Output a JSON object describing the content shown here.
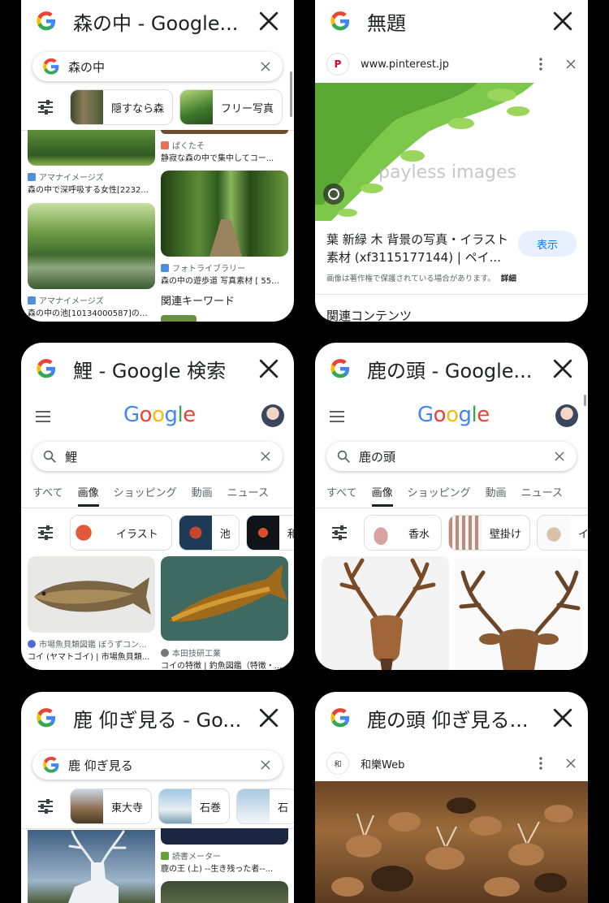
{
  "tabs": [
    {
      "title": "森の中 - Google...",
      "search_query": "森の中",
      "chips": [
        "隠すなら森",
        "フリー写真"
      ],
      "results": [
        {
          "source": "ぱくたそ",
          "caption": "静寂な森の中で集中してコー..."
        },
        {
          "source": "アマナイメージズ",
          "caption": "森の中で深呼吸する女性[2232..."
        },
        {
          "source": "フォトライブラリー",
          "caption": "森の中の遊歩道 写真素材 [ 557..."
        },
        {
          "source": "アマナイメージズ",
          "caption": "森の中の池[10134000587]の写..."
        }
      ],
      "related_label": "関連キーワード"
    },
    {
      "title": "無題",
      "site": "www.pinterest.jp",
      "watermark": "payless images",
      "result_title": "葉 新緑 木 背景の写真・イラスト素材 (xf3115177144) | ペイ...",
      "view_button": "表示",
      "copyright_note": "画像は著作権で保護されている場合があります。",
      "details_link": "詳細",
      "related_content": "関連コンテンツ"
    },
    {
      "title": "鯉 - Google 検索",
      "google_word": "Google",
      "search_query": "鯉",
      "nav_tabs": [
        "すべて",
        "画像",
        "ショッピング",
        "動画",
        "ニュース"
      ],
      "chips": [
        "イラスト",
        "池",
        "和"
      ],
      "results": [
        {
          "source": "市場魚貝類図鑑 ぼうずコン...",
          "caption": "コイ (ヤマトゴイ) | 市場魚貝類..."
        },
        {
          "source": "本田技研工業",
          "caption": "コイの特徴 | 釣魚図鑑（特徴・..."
        }
      ]
    },
    {
      "title": "鹿の頭 - Google...",
      "google_word": "Google",
      "search_query": "鹿の頭",
      "nav_tabs": [
        "すべて",
        "画像",
        "ショッピング",
        "動画",
        "ニュース"
      ],
      "chips": [
        "香水",
        "壁掛け",
        "イ"
      ]
    },
    {
      "title": "鹿 仰ぎ見る - Go...",
      "search_query": "鹿 仰ぎ見る",
      "chips": [
        "東大寺",
        "石巻",
        "石"
      ],
      "results": [
        {
          "source": "読書メーター",
          "caption": "鹿の王 (上) --生き残った者--..."
        }
      ]
    },
    {
      "title": "鹿の頭 仰ぎ見る...",
      "site": "和樂Web"
    }
  ],
  "colors": {
    "blue": "#4285f4",
    "red": "#ea4335",
    "yellow": "#fbbc05",
    "green": "#34a853"
  }
}
